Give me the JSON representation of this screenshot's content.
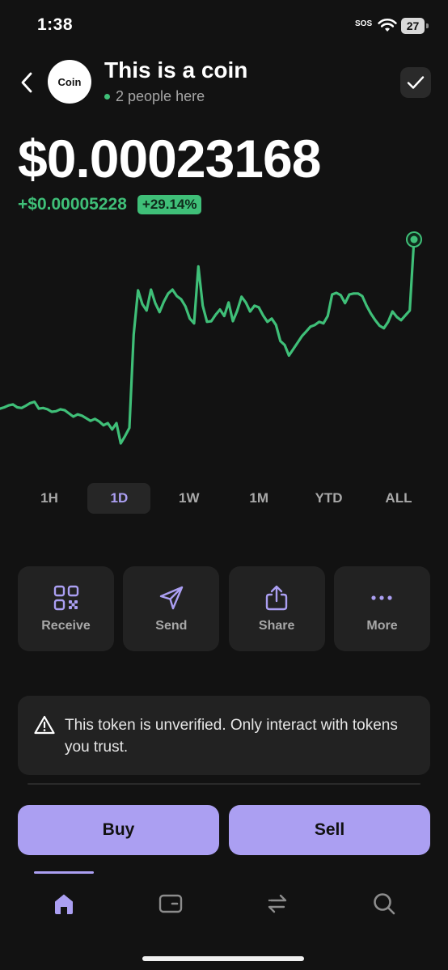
{
  "status_bar": {
    "time": "1:38",
    "sos": "SOS",
    "battery": "27"
  },
  "header": {
    "avatar_text": "Coin",
    "title": "This is a coin",
    "presence": "2 people here"
  },
  "price": {
    "value": "$0.00023168",
    "change": "+$0.00005228",
    "change_pct": "+29.14%"
  },
  "chart_data": {
    "type": "line",
    "color": "#3fbf78",
    "title": "",
    "xlabel": "",
    "ylabel": "",
    "y": [
      0.000179,
      0.0001794,
      0.00018,
      0.0001803,
      0.0001794,
      0.0001792,
      0.0001799,
      0.0001807,
      0.0001811,
      0.000179,
      0.0001792,
      0.0001788,
      0.000178,
      0.0001782,
      0.0001788,
      0.0001785,
      0.0001775,
      0.0001765,
      0.0001772,
      0.0001768,
      0.000176,
      0.0001752,
      0.0001758,
      0.000175,
      0.0001738,
      0.0001745,
      0.0001725,
      0.0001745,
      0.0001682,
      0.0001705,
      0.000173,
      0.000202,
      0.0002158,
      0.0002115,
      0.0002095,
      0.000216,
      0.0002118,
      0.000209,
      0.0002123,
      0.0002148,
      0.000216,
      0.000214,
      0.000213,
      0.0002108,
      0.000207,
      0.0002055,
      0.0002232,
      0.000211,
      0.000206,
      0.0002062,
      0.0002082,
      0.0002098,
      0.0002078,
      0.000212,
      0.0002062,
      0.0002094,
      0.0002138,
      0.000212,
      0.0002092,
      0.000211,
      0.0002105,
      0.000208,
      0.000206,
      0.000207,
      0.000205,
      0.0002,
      0.0001988,
      0.0001955,
      0.0001975,
      0.0001995,
      0.0002015,
      0.000203,
      0.0002045,
      0.000205,
      0.000206,
      0.0002055,
      0.0002078,
      0.0002145,
      0.000215,
      0.0002143,
      0.0002118,
      0.0002145,
      0.0002148,
      0.0002148,
      0.000214,
      0.000211,
      0.0002085,
      0.0002065,
      0.0002048,
      0.000204,
      0.000206,
      0.0002092,
      0.0002075,
      0.0002065,
      0.000208,
      0.0002095,
      0.0002316
    ]
  },
  "time_ranges": [
    "1H",
    "1D",
    "1W",
    "1M",
    "YTD",
    "ALL"
  ],
  "active_range": "1D",
  "actions": [
    {
      "label": "Receive",
      "icon": "qr-code-icon"
    },
    {
      "label": "Send",
      "icon": "send-icon"
    },
    {
      "label": "Share",
      "icon": "share-icon"
    },
    {
      "label": "More",
      "icon": "more-icon"
    }
  ],
  "warning": {
    "icon": "warning-icon",
    "text": "This token is unverified. Only interact with tokens you trust."
  },
  "trade": {
    "buy_label": "Buy",
    "sell_label": "Sell"
  },
  "nav": [
    {
      "icon": "home-icon",
      "active": true
    },
    {
      "icon": "wallet-icon",
      "active": false
    },
    {
      "icon": "swap-icon",
      "active": false
    },
    {
      "icon": "search-icon",
      "active": false
    }
  ],
  "colors": {
    "background": "#121212",
    "accent": "#ab9ff2",
    "positive": "#3fbf78",
    "card": "#222222"
  }
}
